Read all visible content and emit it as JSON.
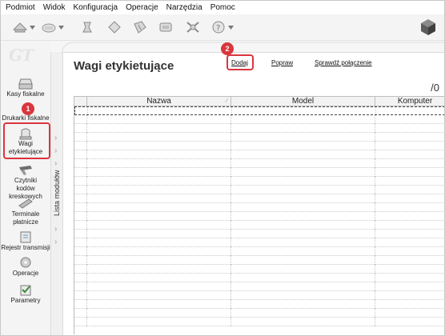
{
  "menu": [
    "Podmiot",
    "Widok",
    "Konfiguracja",
    "Operacje",
    "Narzędzia",
    "Pomoc"
  ],
  "toolbar": {
    "icons": [
      "scale-arrow-icon",
      "scale-icon",
      "gear-icon",
      "tag-icon",
      "barcode-tag-icon",
      "cube-stack-icon",
      "tools-icon",
      "help-icon",
      "package-icon"
    ]
  },
  "logo": "GT",
  "nav": [
    {
      "label": "Kasy fiskalne",
      "icon": "cash-register-icon"
    },
    {
      "label": "Drukarki fiskalne",
      "icon": "fiscal-printer-icon"
    },
    {
      "label": "Wagi etykietujące",
      "icon": "label-scale-icon"
    },
    {
      "label": "Czytniki kodów kreskowych",
      "icon": "barcode-scanner-icon"
    },
    {
      "label": "Terminale płatnicze",
      "icon": "payment-terminal-icon"
    },
    {
      "label": "Rejestr transmisji",
      "icon": "transmission-log-icon"
    },
    {
      "label": "Operacje",
      "icon": "operations-gear-icon"
    },
    {
      "label": "Parametry",
      "icon": "parameters-icon"
    }
  ],
  "strip_label": "Lista modułów",
  "main": {
    "title": "Wagi etykietujące",
    "actions": {
      "add": "Dodaj",
      "edit": "Popraw",
      "check": "Sprawdź połączenie"
    },
    "count": "/0",
    "columns": [
      "Nazwa",
      "Model",
      "Komputer"
    ]
  },
  "annotations": {
    "step1": "1",
    "step2": "2"
  },
  "colors": {
    "highlight": "#d9363e",
    "grid_border": "#bdbdbd"
  }
}
